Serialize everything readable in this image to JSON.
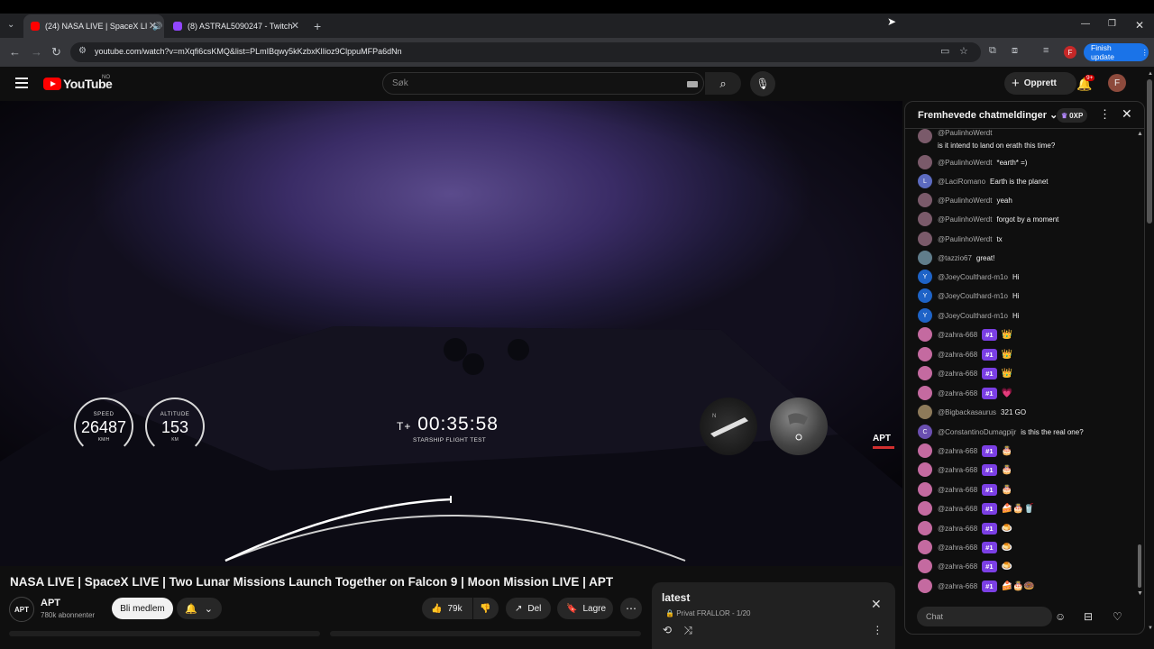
{
  "browser": {
    "tabs": [
      {
        "label": "(24) NASA LIVE | SpaceX LI",
        "active": true
      },
      {
        "label": "(8) ASTRAL5090247 - Twitch",
        "active": false
      }
    ],
    "url": "youtube.com/watch?v=mXqfi6csKMQ&list=PLmIBqwy5kKzbxKlIioz9ClppuMFPa6dNn",
    "update_label": "Finish update"
  },
  "header": {
    "logo_text": "YouTube",
    "country": "NO",
    "search_placeholder": "Søk",
    "create_label": "Opprett",
    "notif_count": "9+",
    "avatar_letter": "F"
  },
  "video": {
    "speed_label": "SPEED",
    "speed_value": "26487",
    "speed_unit": "KM/H",
    "altitude_label": "ALTITUDE",
    "altitude_value": "153",
    "altitude_unit": "KM",
    "clock_prefix": "T+",
    "clock": "00:35:58",
    "clock_sub": "STARSHIP FLIGHT TEST",
    "watermark": "APT"
  },
  "meta": {
    "title": "NASA LIVE | SpaceX LIVE | Two Lunar Missions Launch Together on Falcon 9 | Moon Mission LIVE | APT",
    "channel_name": "APT",
    "channel_avatar": "APT",
    "subscribers": "780k abonnenter",
    "member_label": "Bli medlem",
    "likes": "79k",
    "share_label": "Del",
    "save_label": "Lagre"
  },
  "playlist": {
    "title": "latest",
    "privacy": "Privat",
    "owner_progress": "FRALLOR - 1/20"
  },
  "chat": {
    "header": "Fremhevede chatmeldinger",
    "xp": "0XP",
    "input_placeholder": "Chat",
    "messages": [
      {
        "author": "@PaulinhoWerdt",
        "text": "is it intend to land on erath this time?",
        "avatar_color": "#7a5a6a",
        "initial": ""
      },
      {
        "author": "@PaulinhoWerdt",
        "text": "*earth* =)",
        "avatar_color": "#7a5a6a",
        "initial": ""
      },
      {
        "author": "@LaciRomano",
        "text": "Earth is the planet",
        "avatar_color": "#5c6bc0",
        "initial": "L"
      },
      {
        "author": "@PaulinhoWerdt",
        "text": "yeah",
        "avatar_color": "#7a5a6a",
        "initial": ""
      },
      {
        "author": "@PaulinhoWerdt",
        "text": "forgot by a moment",
        "avatar_color": "#7a5a6a",
        "initial": ""
      },
      {
        "author": "@PaulinhoWerdt",
        "text": "tx",
        "avatar_color": "#7a5a6a",
        "initial": ""
      },
      {
        "author": "@tazzio67",
        "text": "great!",
        "avatar_color": "#607d8b",
        "initial": ""
      },
      {
        "author": "@JoeyCoulthard-m1o",
        "text": "Hi",
        "avatar_color": "#1e63c7",
        "initial": "Y"
      },
      {
        "author": "@JoeyCoulthard-m1o",
        "text": "Hi",
        "avatar_color": "#1e63c7",
        "initial": "Y"
      },
      {
        "author": "@JoeyCoulthard-m1o",
        "text": "Hi",
        "avatar_color": "#1e63c7",
        "initial": "Y"
      },
      {
        "author": "@zahra-668",
        "text": "",
        "badge": "#1",
        "emoji": "👑",
        "avatar_color": "#c46aa0",
        "initial": ""
      },
      {
        "author": "@zahra-668",
        "text": "",
        "badge": "#1",
        "emoji": "👑",
        "avatar_color": "#c46aa0",
        "initial": ""
      },
      {
        "author": "@zahra-668",
        "text": "",
        "badge": "#1",
        "emoji": "👑",
        "avatar_color": "#c46aa0",
        "initial": ""
      },
      {
        "author": "@zahra-668",
        "text": "",
        "badge": "#1",
        "emoji": "💗",
        "avatar_color": "#c46aa0",
        "initial": ""
      },
      {
        "author": "@Bigbackasaurus",
        "text": "321 GO",
        "avatar_color": "#8d7a5a",
        "initial": ""
      },
      {
        "author": "@ConstantinoDumagpijr",
        "text": "is this the real one?",
        "avatar_color": "#6a4fb0",
        "initial": "C"
      },
      {
        "author": "@zahra-668",
        "text": "",
        "badge": "#1",
        "emoji": "🎂",
        "avatar_color": "#c46aa0",
        "initial": ""
      },
      {
        "author": "@zahra-668",
        "text": "",
        "badge": "#1",
        "emoji": "🎂",
        "avatar_color": "#c46aa0",
        "initial": ""
      },
      {
        "author": "@zahra-668",
        "text": "",
        "badge": "#1",
        "emoji": "🎂",
        "avatar_color": "#c46aa0",
        "initial": ""
      },
      {
        "author": "@zahra-668",
        "text": "",
        "badge": "#1",
        "emoji": "🍰🎂🥤",
        "avatar_color": "#c46aa0",
        "initial": ""
      },
      {
        "author": "@zahra-668",
        "text": "",
        "badge": "#1",
        "emoji": "🍮",
        "avatar_color": "#c46aa0",
        "initial": ""
      },
      {
        "author": "@zahra-668",
        "text": "",
        "badge": "#1",
        "emoji": "🍮",
        "avatar_color": "#c46aa0",
        "initial": ""
      },
      {
        "author": "@zahra-668",
        "text": "",
        "badge": "#1",
        "emoji": "🍮",
        "avatar_color": "#c46aa0",
        "initial": ""
      },
      {
        "author": "@zahra-668",
        "text": "",
        "badge": "#1",
        "emoji": "🍰🎂🍩",
        "avatar_color": "#c46aa0",
        "initial": ""
      }
    ]
  },
  "colors": {
    "accent_red": "#ff0000",
    "badge_purple": "#7b3fe4",
    "update_blue": "#1a73e8"
  }
}
